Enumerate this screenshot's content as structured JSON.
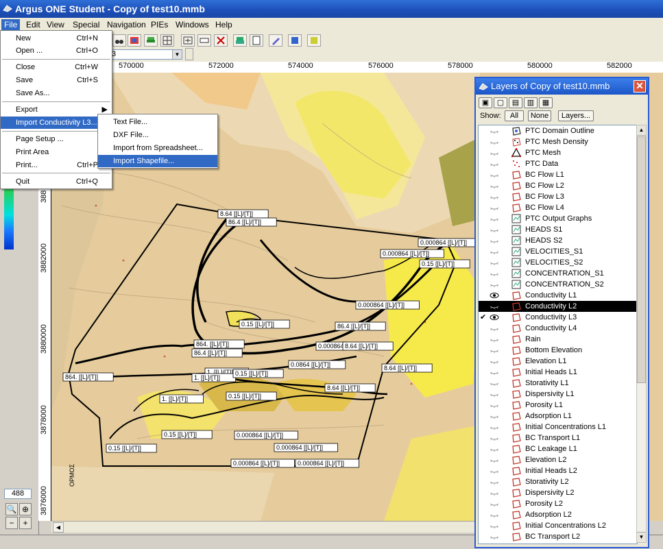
{
  "window": {
    "title": "Argus ONE Student - Copy of test10.mmb"
  },
  "menubar": [
    "File",
    "Edit",
    "View",
    "Special",
    "Navigation",
    "PIEs",
    "Windows",
    "Help"
  ],
  "toolbar": {
    "layer_combo_value": "3"
  },
  "file_menu": {
    "items": [
      {
        "label": "New",
        "shortcut": "Ctrl+N"
      },
      {
        "label": "Open ...",
        "shortcut": "Ctrl+O"
      },
      {
        "label": "Close",
        "shortcut": "Ctrl+W"
      },
      {
        "label": "Save",
        "shortcut": "Ctrl+S"
      },
      {
        "label": "Save As...",
        "shortcut": ""
      },
      {
        "label": "Export",
        "shortcut": ""
      },
      {
        "label": "Import Conductivity L3...",
        "shortcut": ""
      },
      {
        "label": "Page Setup ...",
        "shortcut": ""
      },
      {
        "label": "Print Area",
        "shortcut": ""
      },
      {
        "label": "Print...",
        "shortcut": "Ctrl+P"
      },
      {
        "label": "Quit",
        "shortcut": "Ctrl+Q"
      }
    ]
  },
  "import_submenu": {
    "items": [
      "Text File...",
      "DXF File...",
      "Import from Spreadsheet...",
      "Import Shapefile..."
    ]
  },
  "ruler": {
    "x_ticks": [
      "570000",
      "572000",
      "574000",
      "576000",
      "578000",
      "580000",
      "582000"
    ],
    "y_ticks": [
      "3882000",
      "3880000",
      "3878000",
      "3876000",
      "388"
    ]
  },
  "left_panel": {
    "zoom_value": "488"
  },
  "map_labels": [
    "8.64 [[L]/[T]]",
    "86.4 [[L]/[T]]",
    "0.000864 [[L]/[T]]",
    "0.000864 [[L]/[T]]",
    "0.15 [[L]/[T]]",
    "0.000864 [[L]/[T]]",
    "0.15 [[L]/[T]]",
    "86.4 [[L]/[T]]",
    "864. [[L]/[T]]",
    "86.4 [[L]/[T]]",
    "0.000864",
    "8.64 [[L]/[T]]",
    "0.0864 [[L]/[T]]",
    "8.64 [[L]/[T]]",
    "864. [[L]/[T]]",
    "1. [[L]/[T]]",
    "1. [[L]/[T]]",
    "0.15 [[L]/[T]]",
    "8.64 [[L]/[T]]",
    "1. [[L]/[T]]",
    "0.15 [[L]/[T]]",
    "0.15 [[L]/[T]]",
    "0.000864 [[L]/[T]]",
    "0.000864 [[L]/[T]]",
    "0.15 [[L]/[T]]",
    "0.000864 [[L]/[T]]",
    "0.000864 [[L]/[T]]",
    "ΟΡΜΟΣ"
  ],
  "layers_window": {
    "title": "Layers of Copy of test10.mmb",
    "show_label": "Show:",
    "btn_all": "All",
    "btn_none": "None",
    "btn_layers": "Layers...",
    "layers": [
      {
        "name": "PTC Domain Outline",
        "icon": "domain-icon"
      },
      {
        "name": "PTC Mesh Density",
        "icon": "density-icon"
      },
      {
        "name": "PTC Mesh",
        "icon": "mesh-icon"
      },
      {
        "name": "PTC Data",
        "icon": "data-icon"
      },
      {
        "name": "BC Flow L1",
        "icon": "polygon-icon"
      },
      {
        "name": "BC Flow L2",
        "icon": "polygon-icon"
      },
      {
        "name": "BC Flow L3",
        "icon": "polygon-icon"
      },
      {
        "name": "BC Flow L4",
        "icon": "polygon-icon"
      },
      {
        "name": "PTC Output Graphs",
        "icon": "chart-icon"
      },
      {
        "name": "HEADS S1",
        "icon": "chart-icon"
      },
      {
        "name": "HEADS S2",
        "icon": "chart-icon"
      },
      {
        "name": "VELOCITIES_S1",
        "icon": "chart-icon"
      },
      {
        "name": "VELOCITIES_S2",
        "icon": "chart-icon"
      },
      {
        "name": "CONCENTRATION_S1",
        "icon": "chart-icon"
      },
      {
        "name": "CONCENTRATION_S2",
        "icon": "chart-icon"
      },
      {
        "name": "Conductivity L1",
        "icon": "polygon-icon"
      },
      {
        "name": "Conductivity L2",
        "icon": "polygon-icon"
      },
      {
        "name": "Conductivity L3",
        "icon": "polygon-icon"
      },
      {
        "name": "Conductivity L4",
        "icon": "polygon-icon"
      },
      {
        "name": "Rain",
        "icon": "polygon-icon"
      },
      {
        "name": "Bottom Elevation",
        "icon": "polygon-icon"
      },
      {
        "name": "Elevation L1",
        "icon": "polygon-icon"
      },
      {
        "name": "Initial Heads L1",
        "icon": "polygon-icon"
      },
      {
        "name": "Storativity L1",
        "icon": "polygon-icon"
      },
      {
        "name": "Dispersivity L1",
        "icon": "polygon-icon"
      },
      {
        "name": "Porosity L1",
        "icon": "polygon-icon"
      },
      {
        "name": "Adsorption L1",
        "icon": "polygon-icon"
      },
      {
        "name": "Initial Concentrations L1",
        "icon": "polygon-icon"
      },
      {
        "name": "BC Transport L1",
        "icon": "polygon-icon"
      },
      {
        "name": "BC Leakage L1",
        "icon": "polygon-icon"
      },
      {
        "name": "Elevation L2",
        "icon": "polygon-icon"
      },
      {
        "name": "Initial Heads L2",
        "icon": "polygon-icon"
      },
      {
        "name": "Storativity L2",
        "icon": "polygon-icon"
      },
      {
        "name": "Dispersivity L2",
        "icon": "polygon-icon"
      },
      {
        "name": "Porosity L2",
        "icon": "polygon-icon"
      },
      {
        "name": "Adsorption L2",
        "icon": "polygon-icon"
      },
      {
        "name": "Initial Concentrations L2",
        "icon": "polygon-icon"
      },
      {
        "name": "BC Transport L2",
        "icon": "polygon-icon"
      }
    ]
  },
  "colors": {
    "menu_highlight": "#316ac5",
    "title_blue": "#1c4fb8",
    "map_beige": "#e9d2a6",
    "map_yellow": "#f2e030",
    "polygon_red": "#c0392b"
  }
}
